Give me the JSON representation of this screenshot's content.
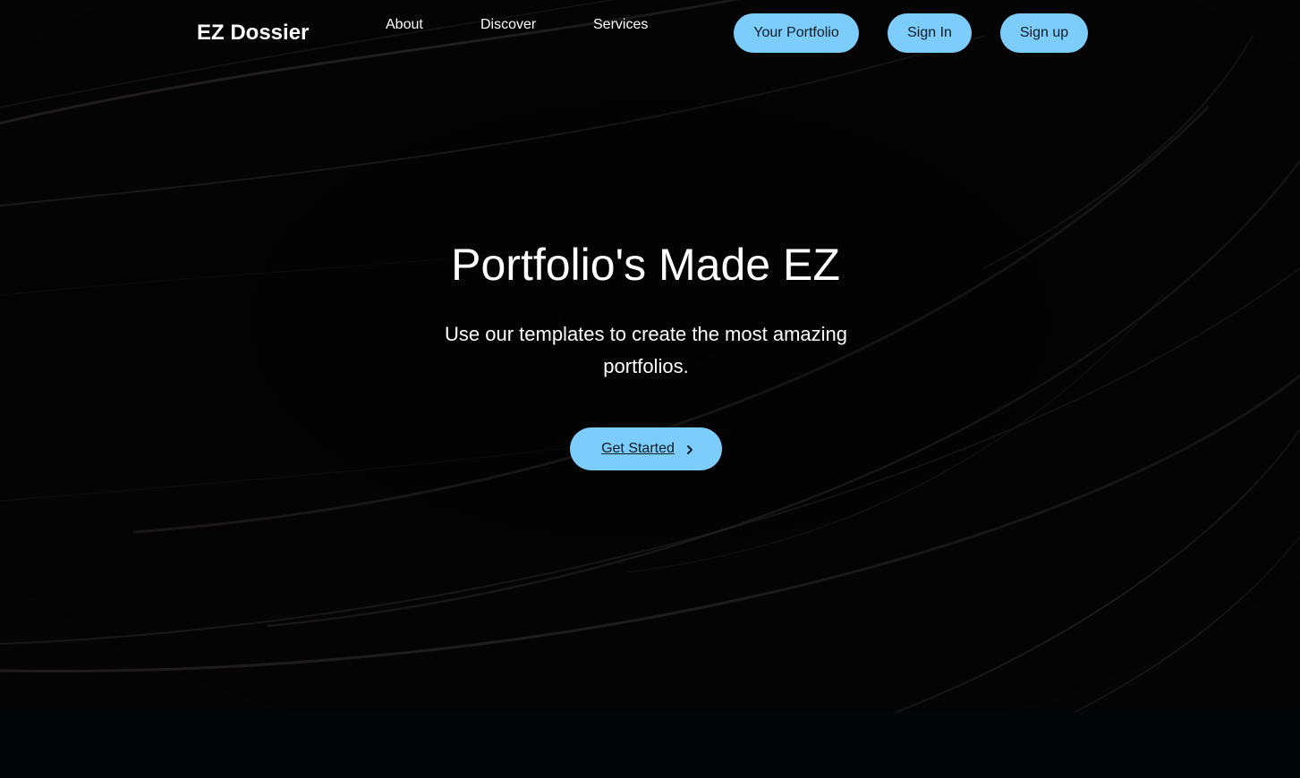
{
  "brand": {
    "name": "EZ Dossier"
  },
  "nav": {
    "links": [
      {
        "label": "About"
      },
      {
        "label": "Discover"
      },
      {
        "label": "Services"
      }
    ],
    "buttons": [
      {
        "label": "Your Portfolio"
      },
      {
        "label": "Sign In"
      },
      {
        "label": "Sign up"
      }
    ]
  },
  "hero": {
    "title": "Portfolio's Made EZ",
    "subtitle": "Use our templates to create the most amazing portfolios.",
    "cta_label": "Get Started",
    "cta_icon": "chevron-right-icon",
    "background": "dark swirl lines"
  },
  "colors": {
    "accent": "#7dcdfc",
    "hero_background": "#030303",
    "footer_background": "#010709",
    "text": "#ffffff",
    "button_text": "#0c1b24"
  }
}
